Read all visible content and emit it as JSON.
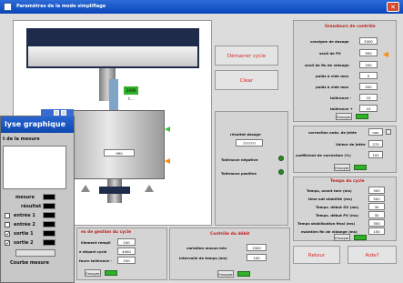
{
  "window": {
    "title": "Paramètres de la mode simplifiage",
    "close": "✕"
  },
  "machine": {
    "value_box": "990",
    "plate_label": "230 ts",
    "small_label": "2X90 t..."
  },
  "buttons": {
    "start_cycle": "Démarrer cycle",
    "clear": "Clear",
    "back": "Retour",
    "help": "Aide?"
  },
  "result": {
    "label": "résultat dosage",
    "value": "???????",
    "neg_tol": "Tolérance négative",
    "pos_tol": "Tolérance positive"
  },
  "control_params": {
    "title": "Grandeurs de contrôle",
    "rows": [
      {
        "label": "consigne de dosage",
        "value": "2000"
      },
      {
        "label": "seuil de PV",
        "value": "950"
      },
      {
        "label": "seuil de fin de vidange",
        "value": "200"
      },
      {
        "label": "poids à vide max",
        "value": "0"
      },
      {
        "label": "poids à vide max",
        "value": "500"
      },
      {
        "label": "tolérance -",
        "value": "10"
      },
      {
        "label": "tolérance +",
        "value": "10"
      }
    ],
    "apply": "Envoyer"
  },
  "corrections": {
    "rows": [
      {
        "label": "correction auto. de jetée",
        "value": "non"
      },
      {
        "label": "Valeur de jetée",
        "value": "270"
      },
      {
        "label": "coefficient de correction (%)",
        "value": "100"
      }
    ],
    "apply": "Envoyer"
  },
  "cycle_times": {
    "title": "Temps du cycle",
    "rows": [
      {
        "label": "Temps, avant tare (ms)",
        "value": "300"
      },
      {
        "label": "time out stabilité (ms)",
        "value": "500"
      },
      {
        "label": "Temps. début GV (ms)",
        "value": "30"
      },
      {
        "label": "Temps. début PV (ms)",
        "value": "30"
      },
      {
        "label": "Temps stabilisation final (ms)",
        "value": "300"
      },
      {
        "label": "maintien fin de vidange (ms)",
        "value": "100"
      }
    ],
    "apply": "Envoyer"
  },
  "cycle_mgmt": {
    "title": "es de gestion du cycle",
    "rows": [
      {
        "label": "illement rempli",
        "value": "100"
      },
      {
        "label": "e départ cycle",
        "value": "4000"
      },
      {
        "label": "fourn tolérance -",
        "value": "100"
      }
    ],
    "apply": "Envoyer"
  },
  "flow_control": {
    "title": "Contrôle du débit",
    "rows": [
      {
        "label": "variation maxon min",
        "value": "1000"
      },
      {
        "label": "intervalle de temps (ms)",
        "value": "100"
      }
    ],
    "apply": "Envoyer"
  },
  "graph_window": {
    "title": "lyse graphique",
    "subtitle": "t de la mesure",
    "legend": [
      {
        "label": "mesure",
        "checked": false,
        "show_box": false
      },
      {
        "label": "résultat",
        "checked": false,
        "show_box": false
      },
      {
        "label": "entrée 1",
        "checked": false,
        "show_box": true
      },
      {
        "label": "entrée 2",
        "checked": false,
        "show_box": true
      },
      {
        "label": "sortie 1",
        "checked": true,
        "show_box": true
      },
      {
        "label": "sortie 2",
        "checked": true,
        "show_box": true
      }
    ],
    "curve": "Courbe mesure"
  }
}
